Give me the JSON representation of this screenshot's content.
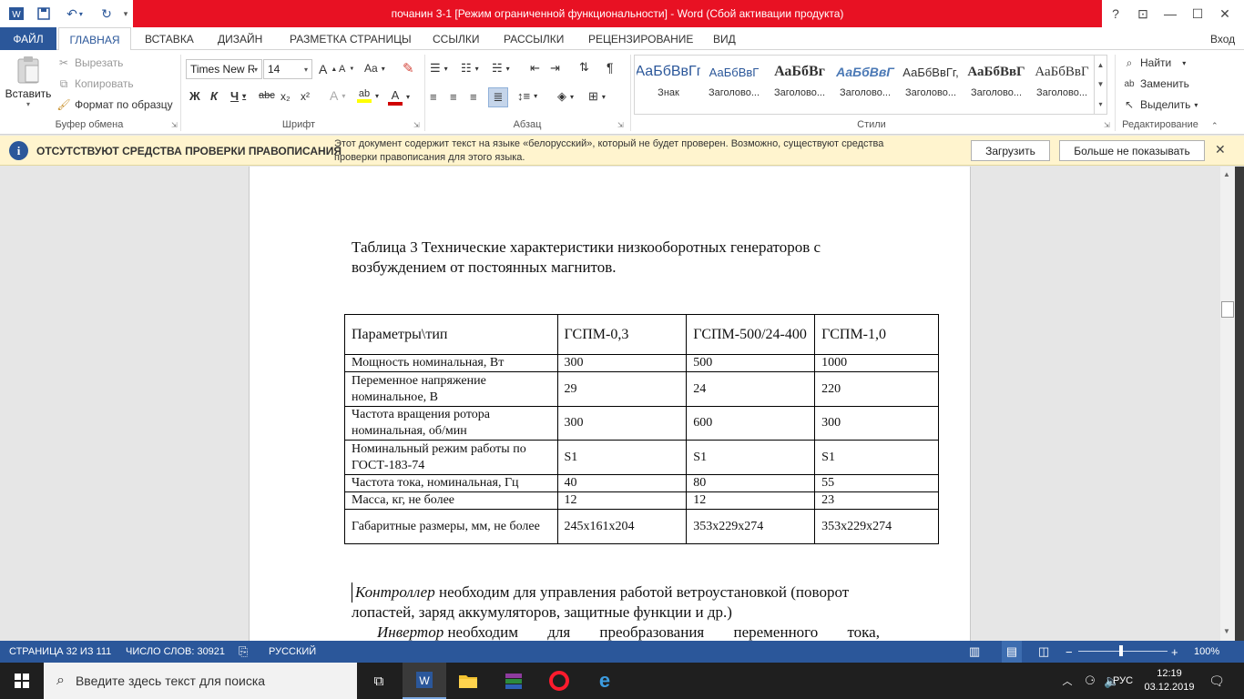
{
  "title": "почанин 3-1 [Режим ограниченной функциональности] -  Word (Сбой активации продукта)",
  "window_controls": {
    "help": "?",
    "restore_ribbon": "⊡",
    "minimize": "—",
    "maximize": "☐",
    "close": "✕"
  },
  "signin": "Вход",
  "tabs": [
    "ФАЙЛ",
    "ГЛАВНАЯ",
    "ВСТАВКА",
    "ДИЗАЙН",
    "РАЗМЕТКА СТРАНИЦЫ",
    "ССЫЛКИ",
    "РАССЫЛКИ",
    "РЕЦЕНЗИРОВАНИЕ",
    "ВИД"
  ],
  "clipboard": {
    "paste": "Вставить",
    "cut": "Вырезать",
    "copy": "Копировать",
    "format_painter": "Формат по образцу",
    "group": "Буфер обмена"
  },
  "font": {
    "name": "Times New R",
    "size": "14",
    "group": "Шрифт",
    "bold": "Ж",
    "italic": "К",
    "underline": "Ч",
    "strike": "abc",
    "sub": "x₂",
    "sup": "x²",
    "grow": "A",
    "shrink": "A",
    "case": "Aa",
    "effects": "A",
    "color": "A"
  },
  "paragraph": {
    "group": "Абзац"
  },
  "styles": {
    "group": "Стили",
    "items": [
      {
        "sample": "АаБбВвГг",
        "name": "Знак"
      },
      {
        "sample": "АаБбВвГ",
        "name": "Заголово..."
      },
      {
        "sample": "АаБбВг",
        "name": "Заголово..."
      },
      {
        "sample": "АаБбВвГ",
        "name": "Заголово..."
      },
      {
        "sample": "АаБбВвГг,",
        "name": "Заголово..."
      },
      {
        "sample": "АаБбВвГ",
        "name": "Заголово..."
      },
      {
        "sample": "АаБбВвГ",
        "name": "Заголово..."
      }
    ]
  },
  "editing": {
    "find": "Найти",
    "replace": "Заменить",
    "select": "Выделить",
    "group": "Редактирование"
  },
  "infobar": {
    "title": "ОТСУТСТВУЮТ СРЕДСТВА ПРОВЕРКИ ПРАВОПИСАНИЯ",
    "message_line1": "Этот документ содержит текст на языке «белорусский», который не будет проверен. Возможно, существуют средства",
    "message_line2": "проверки правописания для этого языка.",
    "download": "Загрузить",
    "dont_show": "Больше не показывать"
  },
  "document": {
    "caption_line1": "Таблица 3  Технические характеристики низкооборотных генераторов с",
    "caption_line2": "возбуждением от постоянных магнитов.",
    "table": {
      "header": [
        "Параметры\\тип",
        "ГСПМ-0,3",
        "ГСПМ-500/24-400",
        "ГСПМ-1,0"
      ],
      "rows": [
        [
          "Мощность номинальная, Вт",
          "300",
          "500",
          "1000"
        ],
        [
          "Переменное напряжение номинальное, В",
          "29",
          "24",
          "220"
        ],
        [
          "Частота вращения ротора номинальная, об/мин",
          "300",
          "600",
          "300"
        ],
        [
          "Номинальный режим работы по ГОСТ-183-74",
          "S1",
          "S1",
          "S1"
        ],
        [
          "Частота тока, номинальная, Гц",
          "40",
          "80",
          "55"
        ],
        [
          "Масса, кг, не более",
          "12",
          "12",
          "23"
        ],
        [
          "Габаритные размеры, мм, не более",
          "245x161x204",
          "353x229x274",
          "353x229x274"
        ]
      ]
    },
    "para1_italic": "Контроллер",
    "para1_rest": "  необходим для управления работой ветроустановкой (поворот",
    "para1_line2": "лопастей, заряд аккумуляторов, защитные функции и др.)",
    "para2_italic": "Инвертор",
    "para2_rest": "необходим для преобразования переменного тока,"
  },
  "status": {
    "page": "СТРАНИЦА 32 ИЗ 111",
    "words": "ЧИСЛО СЛОВ: 30921",
    "language": "РУССКИЙ",
    "zoom": "100%",
    "zoom_minus": "−",
    "zoom_plus": "+"
  },
  "taskbar": {
    "search_placeholder": "Введите здесь текст для поиска",
    "lang": "РУС",
    "time": "12:19",
    "date": "03.12.2019"
  },
  "colors": {
    "word_blue": "#2b579a",
    "title_red": "#e81123",
    "info_yellow": "#fff4ce"
  }
}
